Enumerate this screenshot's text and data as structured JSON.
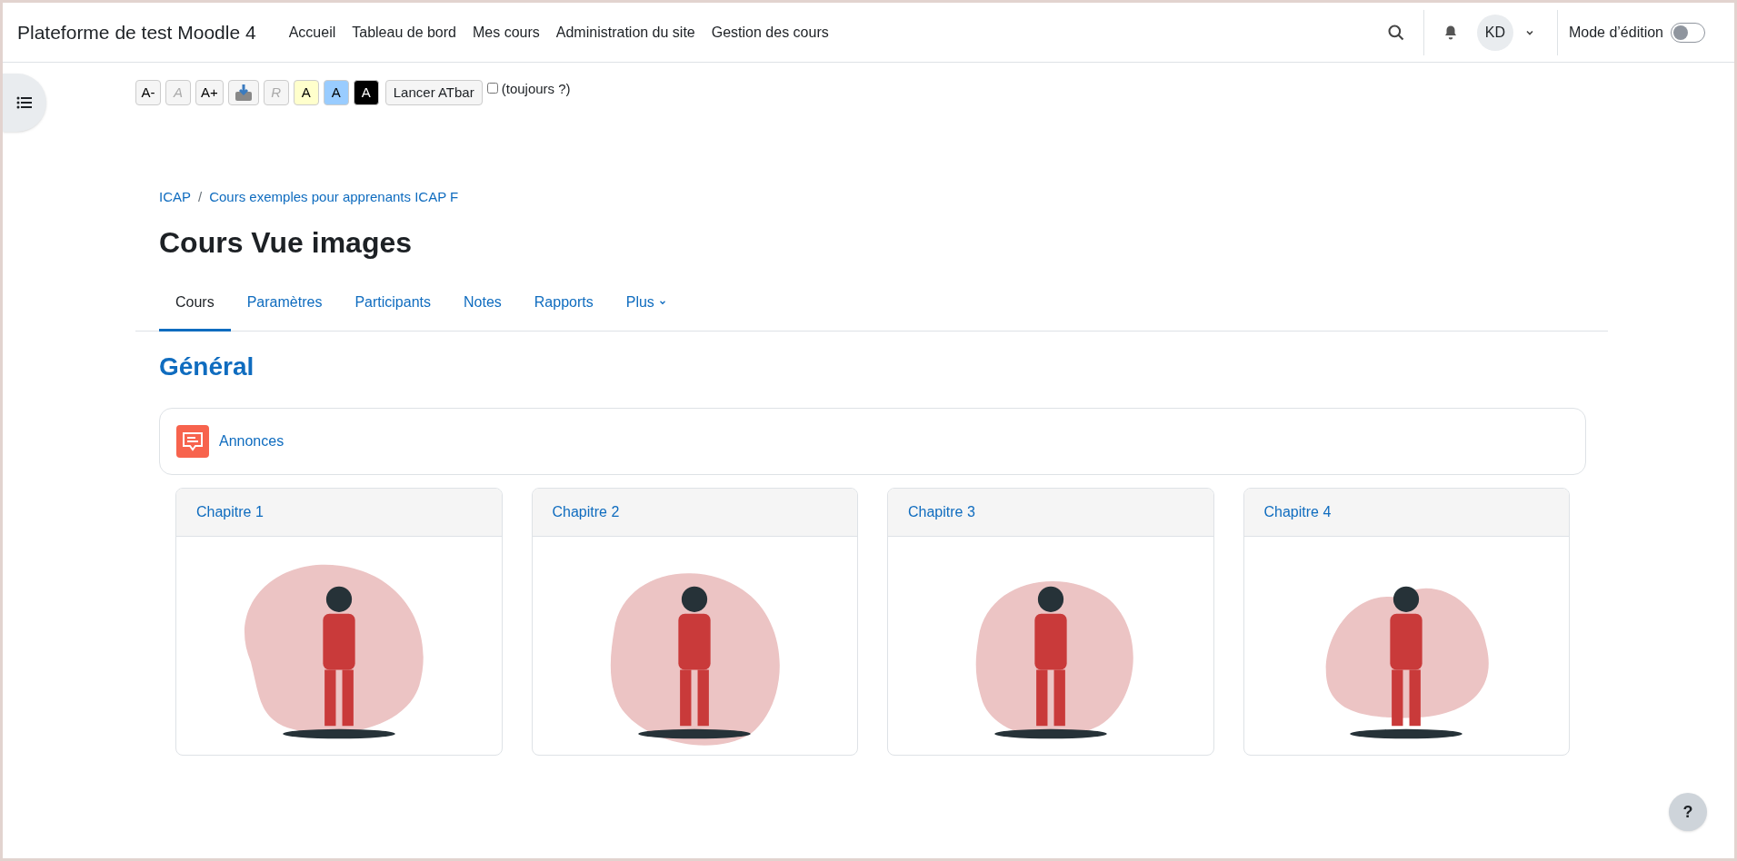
{
  "navbar": {
    "site_name": "Plateforme de test Moodle 4",
    "links": [
      "Accueil",
      "Tableau de bord",
      "Mes cours",
      "Administration du site",
      "Gestion des cours"
    ],
    "avatar": "KD",
    "edit_mode": {
      "label": "Mode d’édition",
      "on": false
    }
  },
  "atbar": {
    "buttons": [
      {
        "kind": "text",
        "label": "A-",
        "disabled": false
      },
      {
        "kind": "text",
        "label": "A",
        "disabled": true
      },
      {
        "kind": "text",
        "label": "A+",
        "disabled": false
      },
      {
        "kind": "icon"
      },
      {
        "kind": "text",
        "label": "R",
        "disabled": true
      },
      {
        "kind": "yellow",
        "label": "A",
        "disabled": false
      },
      {
        "kind": "blue",
        "label": "A",
        "disabled": false
      },
      {
        "kind": "black",
        "label": "A",
        "disabled": false
      }
    ],
    "launch": "Lancer ATbar",
    "always": {
      "label": "(toujours ?)",
      "checked": false
    }
  },
  "breadcrumb": [
    "ICAP",
    "Cours exemples pour apprenants ICAP F"
  ],
  "breadcrumb_separator": "/",
  "title": "Cours Vue images",
  "tabs": [
    {
      "label": "Cours",
      "selected": true
    },
    {
      "label": "Paramètres",
      "selected": false
    },
    {
      "label": "Participants",
      "selected": false
    },
    {
      "label": "Notes",
      "selected": false
    },
    {
      "label": "Rapports",
      "selected": false
    },
    {
      "label": "Plus",
      "selected": false,
      "dropdown": true
    }
  ],
  "section": {
    "title": "Général",
    "activities": [
      "Annonces"
    ]
  },
  "chapters": [
    {
      "title": "Chapitre 1"
    },
    {
      "title": "Chapitre 2"
    },
    {
      "title": "Chapitre 3"
    },
    {
      "title": "Chapitre 4"
    }
  ],
  "help": "?"
}
